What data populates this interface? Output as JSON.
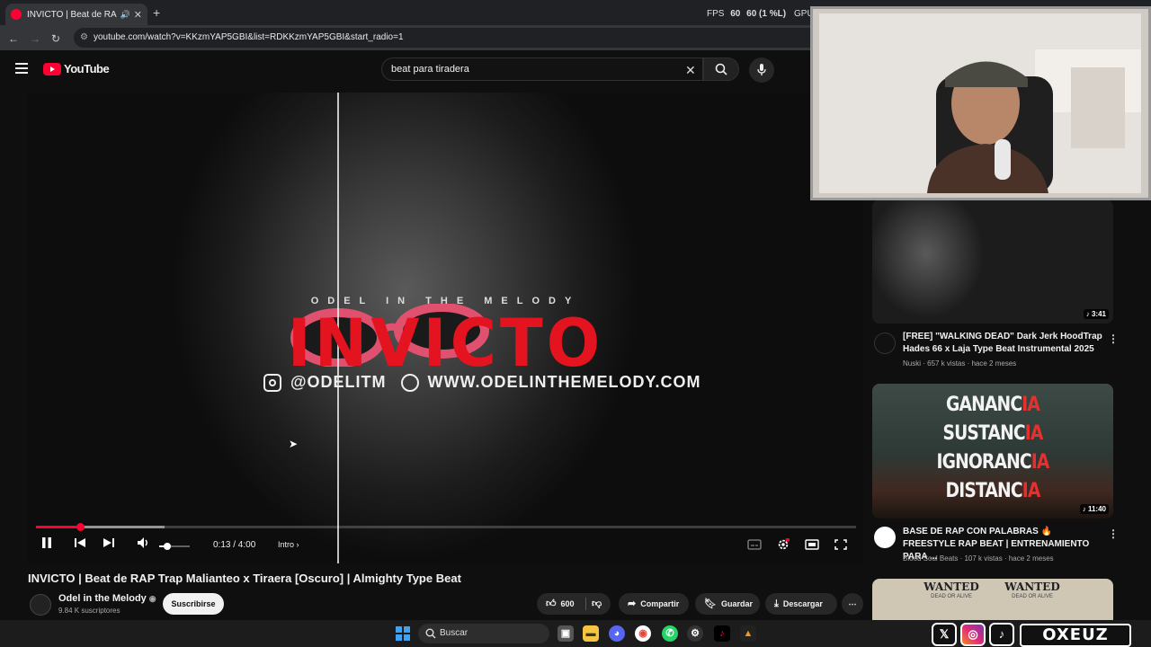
{
  "browser": {
    "tab_title": "INVICTO | Beat de RAP Trap",
    "new_tab": "+",
    "url": "youtube.com/watch?v=KKzmYAP5GBI&list=RDKKzmYAP5GBI&start_radio=1"
  },
  "overlay": {
    "fps_label": "FPS",
    "fps_value": "60",
    "fps_detail": "60 (1 %L)",
    "gpu_label": "GPU"
  },
  "youtube": {
    "logo_text": "YouTube",
    "search_value": "beat para tiradera"
  },
  "player": {
    "art_brand": "ODEL IN THE MELODY",
    "art_title": "INVICTO",
    "art_instagram": "@ODELITM",
    "art_website": "WWW.ODELINTHEMELODY.COM",
    "time_current": "0:13",
    "time_total": "4:00",
    "time_display": "0:13 / 4:00",
    "chapter": "Intro",
    "progress_fraction": 0.054,
    "buffered_fraction": 0.157,
    "volume_fraction": 0.25
  },
  "video": {
    "title": "INVICTO | Beat de RAP Trap Malianteo x Tiraera [Oscuro] | Almighty Type Beat",
    "channel": "Odel in the Melody",
    "subscribers": "9.84 K suscriptores",
    "subscribe_label": "Suscribirse",
    "likes": "600",
    "share_label": "Compartir",
    "save_label": "Guardar",
    "download_label": "Descargar"
  },
  "recommendations": [
    {
      "title": "[FREE] \"WALKING DEAD\" Dark Jerk HoodTrap Hades 66 x Laja Type Beat Instrumental 2025",
      "channel": "Nuski",
      "meta": "657 k vistas · hace 2 meses",
      "duration": "3:41"
    },
    {
      "title": "BASE DE RAP CON PALABRAS 🔥 FREESTYLE RAP BEAT | ENTRENAMIENTO PARA ...",
      "channel": "Blood Soul Beats",
      "meta": "107 k vistas · hace 2 meses",
      "duration": "11:40",
      "thumb_lines": [
        {
          "a": "GANANC",
          "b": "IA"
        },
        {
          "a": "SUSTANC",
          "b": "IA"
        },
        {
          "a": "IGNORANC",
          "b": "IA"
        },
        {
          "a": "DISTANC",
          "b": "IA"
        }
      ]
    },
    {
      "thumb_text_1": "WANTED",
      "thumb_sub_1": "DEAD OR ALIVE",
      "thumb_text_2": "WANTED",
      "thumb_sub_2": "DEAD OR ALIVE"
    }
  ],
  "taskbar": {
    "search_placeholder": "Buscar"
  },
  "stream_overlay": {
    "handle": "OXEUZ"
  },
  "colors": {
    "brand_red": "#ff0033",
    "art_red": "#e3141f",
    "background": "#0f0f0f"
  }
}
